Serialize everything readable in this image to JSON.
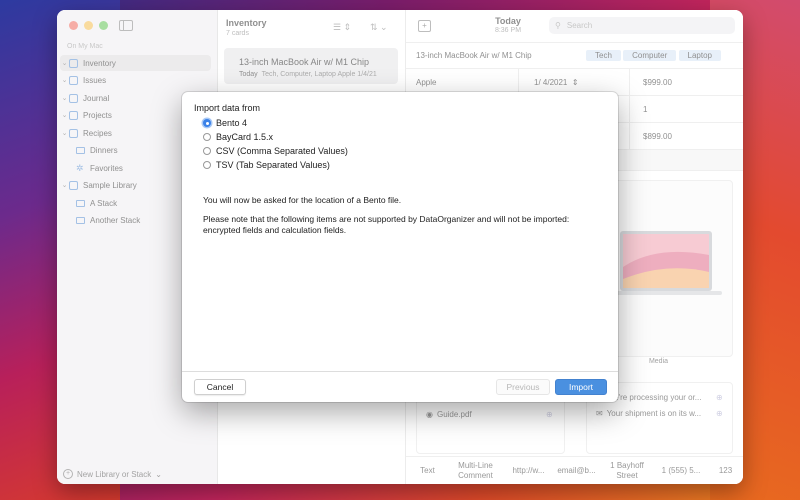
{
  "colors": {
    "accent": "#3b82e8",
    "tag_bg": "#d6e4f4",
    "traffic_red": "#ee6a5e",
    "traffic_yellow": "#f5bd4f",
    "traffic_green": "#61c454"
  },
  "sidebar": {
    "section_header": "On My Mac",
    "items": [
      {
        "label": "Inventory",
        "icon": "stack-icon",
        "chevron": "chevron-down-icon"
      },
      {
        "label": "Issues",
        "icon": "stack-icon",
        "chevron": "chevron-down-icon"
      },
      {
        "label": "Journal",
        "icon": "stack-icon",
        "chevron": "chevron-down-icon"
      },
      {
        "label": "Projects",
        "icon": "stack-icon",
        "chevron": "chevron-down-icon"
      },
      {
        "label": "Recipes",
        "icon": "stack-icon",
        "chevron": "chevron-down-icon"
      },
      {
        "label": "Dinners",
        "icon": "folder-icon"
      },
      {
        "label": "Favorites",
        "icon": "star-icon"
      },
      {
        "label": "Sample Library",
        "icon": "stack-icon",
        "chevron": "chevron-down-icon"
      },
      {
        "label": "A Stack",
        "icon": "folder-icon"
      },
      {
        "label": "Another Stack",
        "icon": "folder-icon"
      }
    ],
    "new_library": "New Library or Stack"
  },
  "list": {
    "title": "Inventory",
    "count": "7 cards",
    "card": {
      "title": "13-inch MacBook Air w/ M1 Chip",
      "date": "Today",
      "sub": "Tech, Computer, Laptop  Apple  1/4/21"
    }
  },
  "detail": {
    "today": "Today",
    "time": "8:36 PM",
    "search_placeholder": "Search",
    "name": "13-inch MacBook Air w/ M1 Chip",
    "tags": [
      "Tech",
      "Computer",
      "Laptop"
    ],
    "maker": "Apple",
    "date": "1/  4/2021",
    "price": "$999.00",
    "qty": "1",
    "price2": "$899.00",
    "media_label": "Media",
    "attachment": "Guide.pdf",
    "messages": [
      "We're processing your or...",
      "Your shipment is on its w..."
    ],
    "footer": [
      "Text",
      "Multi-Line Comment",
      "http://w...",
      "email@b...",
      "1 Bayhoff Street",
      "1 (555) 5...",
      "123"
    ]
  },
  "dialog": {
    "title": "Import data from",
    "options": [
      {
        "label": "Bento 4",
        "selected": true
      },
      {
        "label": "BayCard 1.5.x",
        "selected": false
      },
      {
        "label": "CSV (Comma Separated Values)",
        "selected": false
      },
      {
        "label": "TSV (Tab Separated Values)",
        "selected": false
      }
    ],
    "message1": "You will now be asked for the location of a Bento file.",
    "message2": "Please note that the following items are not supported by DataOrganizer and will not be imported: encrypted fields and calculation fields.",
    "cancel": "Cancel",
    "previous": "Previous",
    "import": "Import"
  }
}
